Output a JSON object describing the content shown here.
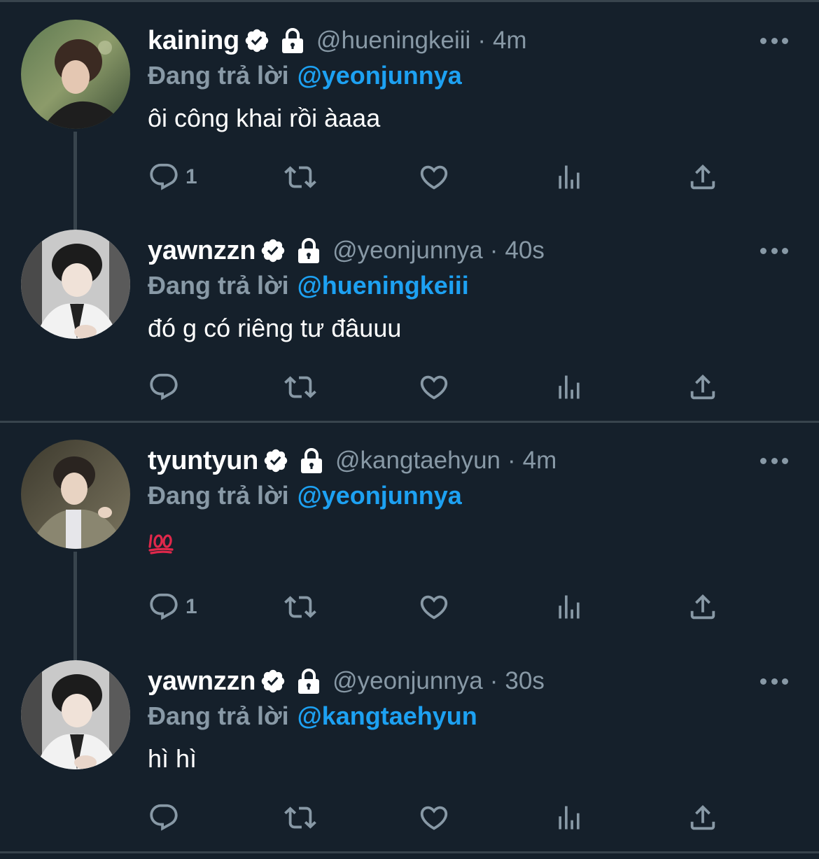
{
  "tweets": [
    {
      "name": "kaining",
      "handle": "@hueningkeiii",
      "separator": "·",
      "time": "4m",
      "reply_prefix": "Đang trả lời",
      "reply_to": "@yeonjunnya",
      "text": "ôi công khai rồi àaaa",
      "reply_count": "1"
    },
    {
      "name": "yawnzzn",
      "handle": "@yeonjunnya",
      "separator": "·",
      "time": "40s",
      "reply_prefix": "Đang trả lời",
      "reply_to": "@hueningkeiii",
      "text": "đó g có riêng tư đâuuu",
      "reply_count": ""
    },
    {
      "name": "tyuntyun",
      "handle": "@kangtaehyun",
      "separator": "·",
      "time": "4m",
      "reply_prefix": "Đang trả lời",
      "reply_to": "@yeonjunnya",
      "text": "",
      "emoji": "100-emoji",
      "reply_count": "1"
    },
    {
      "name": "yawnzzn",
      "handle": "@yeonjunnya",
      "separator": "·",
      "time": "30s",
      "reply_prefix": "Đang trả lời",
      "reply_to": "@kangtaehyun",
      "text": "hì hì",
      "reply_count": ""
    }
  ],
  "icons": {
    "verified": "verified-badge-icon",
    "protected": "lock-icon",
    "more": "more-icon",
    "reply": "reply-icon",
    "retweet": "retweet-icon",
    "like": "like-icon",
    "analytics": "analytics-icon",
    "share": "share-icon"
  },
  "colors": {
    "background": "#15202b",
    "divider": "#38444d",
    "secondary_text": "#8899a6",
    "link": "#1da1f2",
    "emoji_red": "#e0284b"
  }
}
